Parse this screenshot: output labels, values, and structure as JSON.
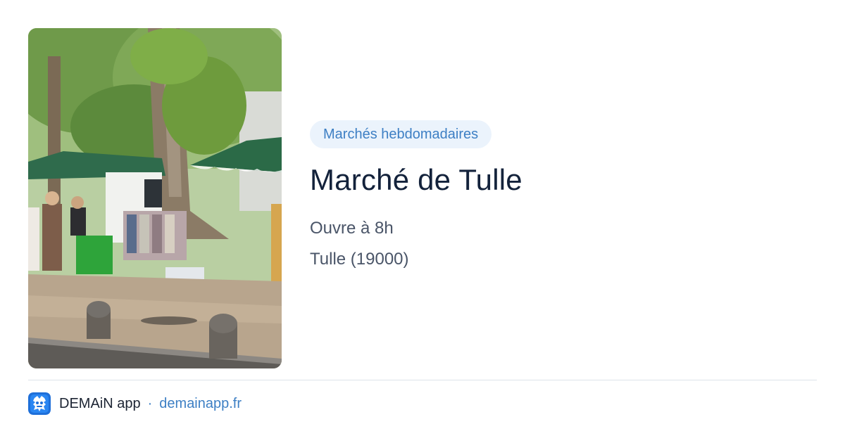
{
  "photo": {
    "description_icon": "market-photo"
  },
  "event": {
    "category": "Marchés hebdomadaires",
    "title": "Marché de Tulle",
    "opening": "Ouvre à 8h",
    "location": "Tulle (19000)"
  },
  "footer": {
    "app_name": "DEMAiN app",
    "separator": "·",
    "domain": "demainapp.fr",
    "logo_icon": "demain-app-logo"
  },
  "colors": {
    "accent": "#3d7fc4",
    "badge_bg": "#ebf3fc",
    "title": "#13223b",
    "text": "#4a5568"
  }
}
